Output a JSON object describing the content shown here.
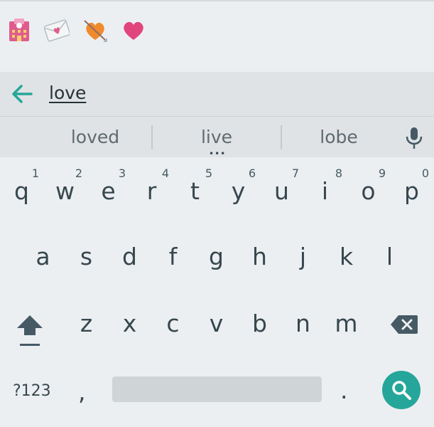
{
  "emoji_bar": {
    "items": [
      {
        "name": "love-hotel-emoji",
        "color": "#e05c8d"
      },
      {
        "name": "love-letter-emoji",
        "color": "#e05c8d"
      },
      {
        "name": "heart-with-arrow-emoji",
        "color": "#f08a2c"
      },
      {
        "name": "heart-emoji",
        "color": "#e0457b"
      }
    ]
  },
  "search": {
    "query": "love",
    "back_icon": "arrow-left-icon"
  },
  "suggestions": {
    "items": [
      "loved",
      "live",
      "lobe"
    ],
    "more_indicator": "•••",
    "mic_icon": "microphone-icon"
  },
  "keyboard": {
    "row1": [
      "q",
      "w",
      "e",
      "r",
      "t",
      "y",
      "u",
      "i",
      "o",
      "p"
    ],
    "row1_hints": [
      "1",
      "2",
      "3",
      "4",
      "5",
      "6",
      "7",
      "8",
      "9",
      "0"
    ],
    "row2": [
      "a",
      "s",
      "d",
      "f",
      "g",
      "h",
      "j",
      "k",
      "l"
    ],
    "row3": [
      "z",
      "x",
      "c",
      "v",
      "b",
      "n",
      "m"
    ],
    "symbols_label": "?123",
    "comma": ",",
    "period": ".",
    "shift_icon": "shift-icon",
    "backspace_icon": "backspace-icon",
    "search_icon": "search-icon"
  },
  "colors": {
    "accent": "#26a69a",
    "background": "#eceff1",
    "key_text": "#37474f"
  }
}
